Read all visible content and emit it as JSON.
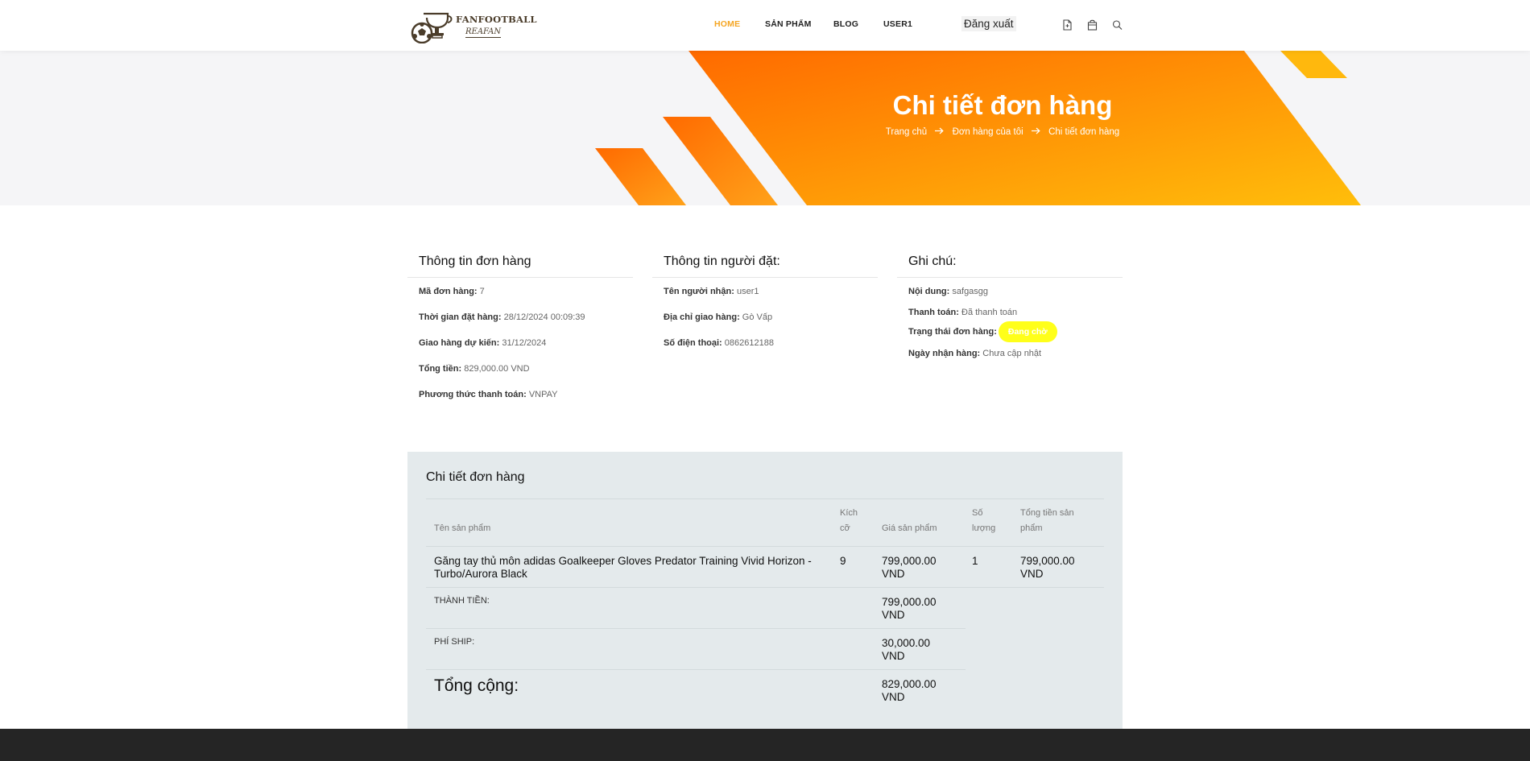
{
  "brand": {
    "name": "FANFOOTBALL",
    "tagline": "REAFAN"
  },
  "nav": {
    "items": [
      "HOME",
      "SẢN PHẨM",
      "BLOG",
      "USER1"
    ],
    "logout_label": "Đăng xuất",
    "active_color": "#f5a623"
  },
  "icons": {
    "order": "document-icon",
    "cart": "shopping-bag-icon",
    "search": "search-icon"
  },
  "banner": {
    "title": "Chi tiết đơn hàng",
    "breadcrumb": [
      "Trang chủ",
      "Đơn hàng của tôi",
      "Chi tiết đơn hàng"
    ],
    "gradient_start": "#ff6a00",
    "gradient_end": "#ffbe0b"
  },
  "order_info": {
    "title": "Thông tin đơn hàng",
    "fields": [
      {
        "label": "Mã đơn hàng:",
        "value": "7"
      },
      {
        "label": "Thời gian đặt hàng:",
        "value": "28/12/2024 00:09:39"
      },
      {
        "label": "Giao hàng dự kiến:",
        "value": "31/12/2024"
      },
      {
        "label": "Tổng tiền:",
        "value": "829,000.00 VND"
      },
      {
        "label": "Phương thức thanh toán:",
        "value": "VNPAY"
      }
    ]
  },
  "buyer_info": {
    "title": "Thông tin người đặt:",
    "fields": [
      {
        "label": "Tên người nhận:",
        "value": "user1"
      },
      {
        "label": "Địa chỉ giao hàng:",
        "value": "Gò Vấp"
      },
      {
        "label": "Số điện thoại:",
        "value": "0862612188"
      }
    ]
  },
  "notes": {
    "title": "Ghi chú:",
    "content_label": "Nội dung:",
    "content_value": "safgasgg",
    "payment_label": "Thanh toán:",
    "payment_value": "Đã thanh toán",
    "status_label": "Trạng thái đơn hàng:",
    "status_value": "Đang chờ",
    "status_color": "#ffff1a",
    "received_label": "Ngày nhận hàng:",
    "received_value": "Chưa cập nhật"
  },
  "details": {
    "title": "Chi tiết đơn hàng",
    "headers": {
      "name": "Tên sản phẩm",
      "size": "Kích cỡ",
      "price": "Giá sản phẩm",
      "qty": "Số lượng",
      "total": "Tổng tiền sản phẩm"
    },
    "items": [
      {
        "name": "Găng tay thủ môn adidas Goalkeeper Gloves Predator Training Vivid Horizon - Turbo/Aurora Black",
        "size": "9",
        "price": "799,000.00 VND",
        "qty": "1",
        "total": "799,000.00 VND"
      }
    ],
    "subtotal_label": "THÀNH TIỀN:",
    "subtotal_value": "799,000.00 VND",
    "shipping_label": "PHÍ SHIP:",
    "shipping_value": "30,000.00 VND",
    "grand_total_label": "Tổng cộng:",
    "grand_total_value": "829,000.00 VND"
  }
}
